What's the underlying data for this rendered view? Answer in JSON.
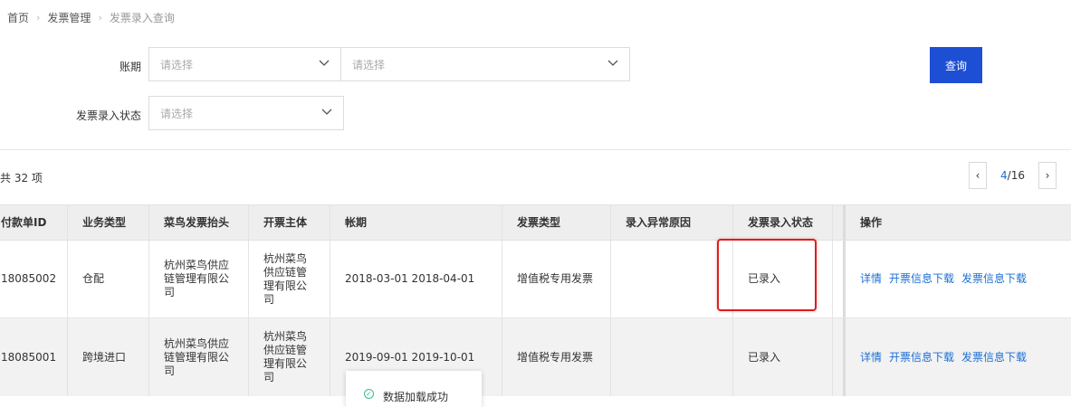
{
  "breadcrumb": {
    "home": "首页",
    "section": "发票管理",
    "current": "发票录入查询"
  },
  "filters": {
    "period_label": "账期",
    "period_start_placeholder": "请选择",
    "period_end_placeholder": "请选择",
    "status_label": "发票录入状态",
    "status_placeholder": "请选择",
    "query_button": "查询"
  },
  "summary": {
    "total_text": "共 32 项"
  },
  "pagination": {
    "current": "4",
    "total": "/16",
    "prev": "‹",
    "next": "›"
  },
  "table": {
    "headers": [
      "付款单ID",
      "业务类型",
      "菜鸟发票抬头",
      "开票主体",
      "帐期",
      "发票类型",
      "录入异常原因",
      "发票录入状态",
      "操作"
    ],
    "rows": [
      {
        "id": "18085002",
        "biz_type": "仓配",
        "title": "杭州菜鸟供应链管理有限公司",
        "issuer": "杭州菜鸟供应链管理有限公司",
        "period": "2018-03-01 2018-04-01",
        "invoice_type": "增值税专用发票",
        "error_reason": "",
        "status": "已录入",
        "actions": [
          "详情",
          "开票信息下载",
          "发票信息下载"
        ]
      },
      {
        "id": "18085001",
        "biz_type": "跨境进口",
        "title": "杭州菜鸟供应链管理有限公司",
        "issuer": "杭州菜鸟供应链管理有限公司",
        "period": "2019-09-01 2019-10-01",
        "invoice_type": "增值税专用发票",
        "error_reason": "",
        "status": "已录入",
        "actions": [
          "详情",
          "开票信息下载",
          "发票信息下载"
        ]
      }
    ]
  },
  "toast": {
    "message": "数据加载成功"
  },
  "colors": {
    "primary": "#1d4fd4",
    "link": "#1d6fd4",
    "highlight": "#e01d1d",
    "success": "#3cbc8d"
  }
}
